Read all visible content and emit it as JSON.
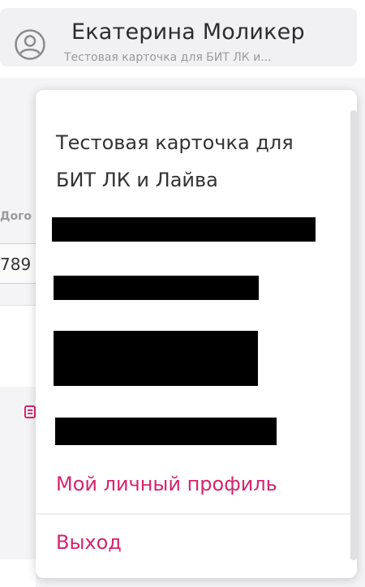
{
  "header": {
    "user_name": "Екатерина Моликер",
    "user_subtitle": "Тестовая карточка для БИТ ЛК и...",
    "avatar_icon": "user-circle-icon"
  },
  "background": {
    "field_label": "Дого",
    "field_value": "789",
    "icon": "document-icon"
  },
  "menu": {
    "title": "Тестовая карточка для БИТ ЛК и Лайва",
    "items": [
      {
        "label": "Мой личный профиль"
      },
      {
        "label": "Выход"
      }
    ]
  },
  "colors": {
    "accent": "#d6246e",
    "text": "#333333",
    "muted": "#9a9a9a"
  }
}
